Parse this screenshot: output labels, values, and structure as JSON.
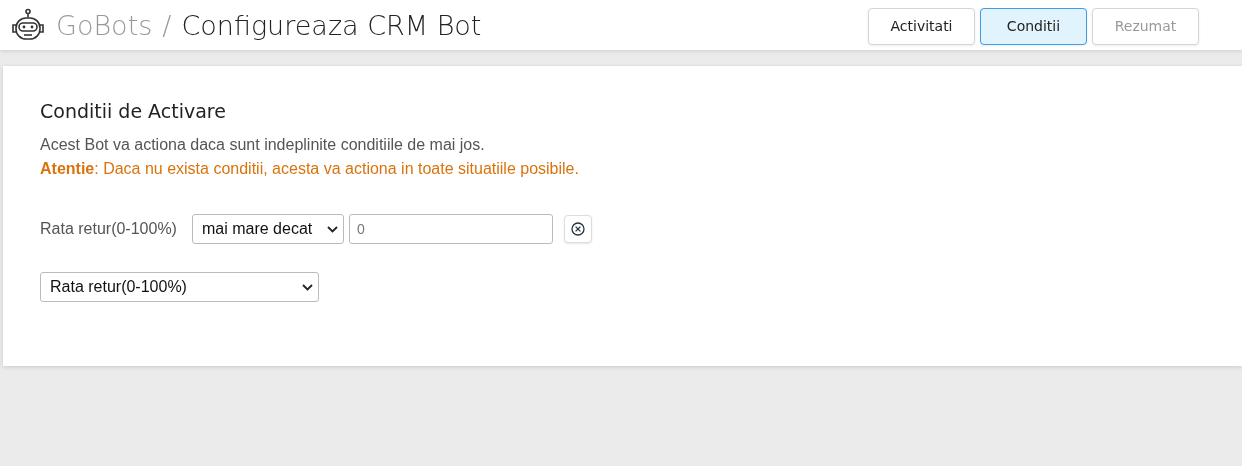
{
  "header": {
    "brand": "GoBots",
    "separator": "/",
    "title": "Configureaza CRM Bot"
  },
  "tabs": [
    {
      "label": "Activitati",
      "selected": false,
      "disabled": false
    },
    {
      "label": "Conditii",
      "selected": true,
      "disabled": false
    },
    {
      "label": "Rezumat",
      "selected": false,
      "disabled": true
    }
  ],
  "card": {
    "title": "Conditii de Activare",
    "description": "Acest Bot va actiona daca sunt indeplinite conditiile de mai jos.",
    "warning": "**Atentie**: Daca nu exista conditii, acesta va actiona in toate situatiile posibile."
  },
  "conditions": [
    {
      "label": "Rata retur(0-100%)",
      "operator": "mai mare decat",
      "placeholder": "0"
    }
  ],
  "add_condition": {
    "value": "Rata retur(0-100%)"
  }
}
